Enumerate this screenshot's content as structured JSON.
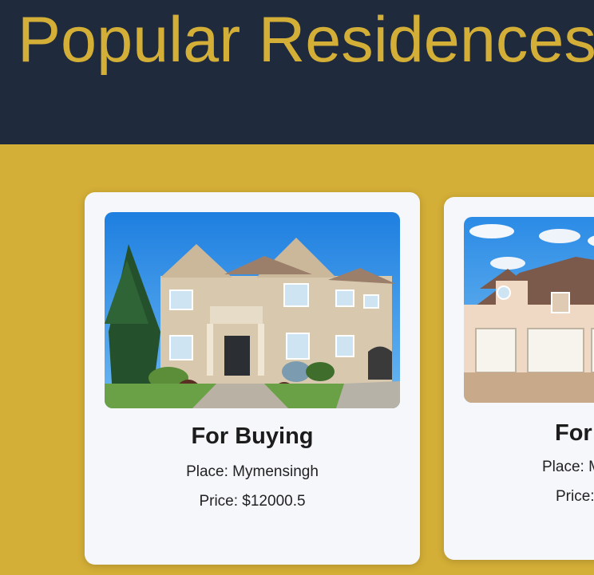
{
  "header": {
    "title": "Popular Residences",
    "bg_color": "#1f2a3c",
    "title_color": "#d4af37"
  },
  "page": {
    "bg_color": "#d4af37"
  },
  "cards": [
    {
      "image_icon": "house-photo-icon",
      "title": "For Buying",
      "place": "Place: Mymensingh",
      "price": "Price: $12000.5"
    },
    {
      "image_icon": "house-photo-icon",
      "title": "For",
      "place": "Place: M",
      "price": "Price:"
    }
  ]
}
